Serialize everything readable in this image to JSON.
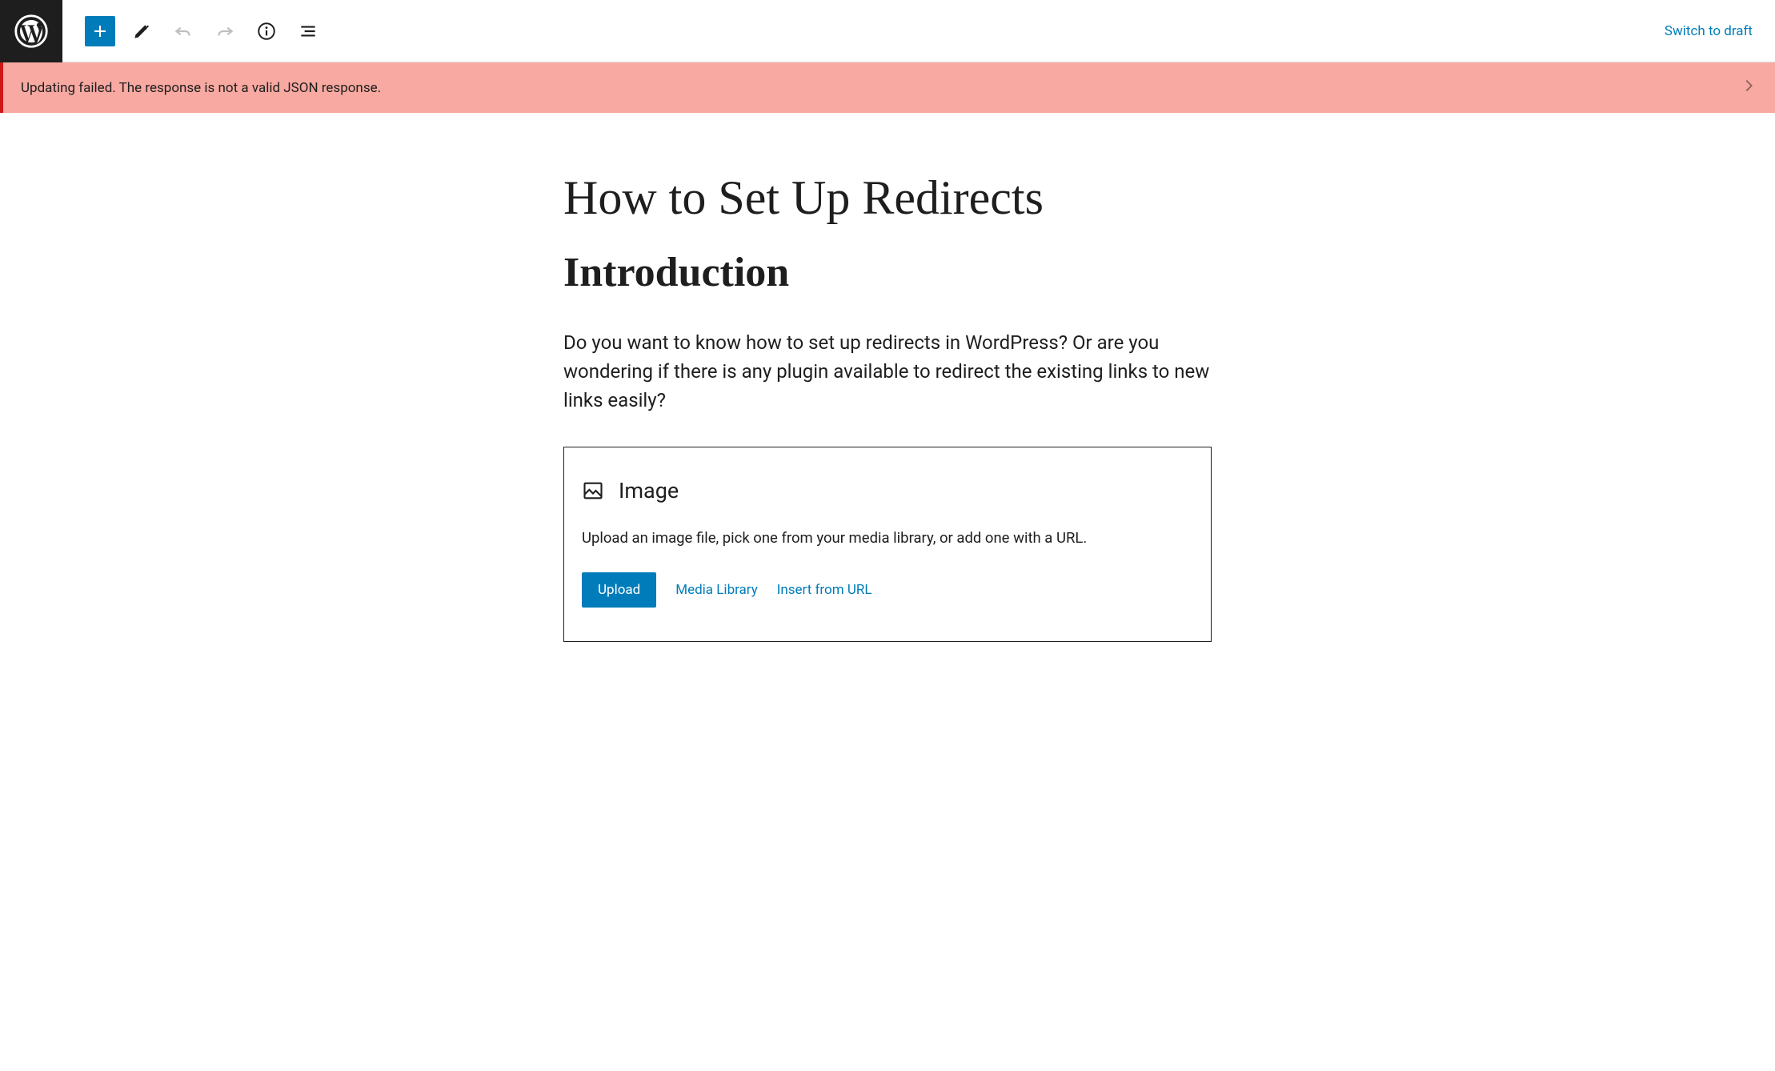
{
  "topbar": {
    "switch_draft_label": "Switch to draft"
  },
  "error": {
    "message": "Updating failed. The response is not a valid JSON response."
  },
  "post": {
    "title": "How to Set Up Redirects",
    "heading": "Introduction",
    "paragraph": "Do you want to know how to set up redirects in WordPress?  Or are you wondering if there is any plugin available to redirect the existing links to new links easily?"
  },
  "image_block": {
    "label": "Image",
    "description": "Upload an image file, pick one from your media library, or add one with a URL.",
    "upload_label": "Upload",
    "media_library_label": "Media Library",
    "insert_url_label": "Insert from URL"
  }
}
